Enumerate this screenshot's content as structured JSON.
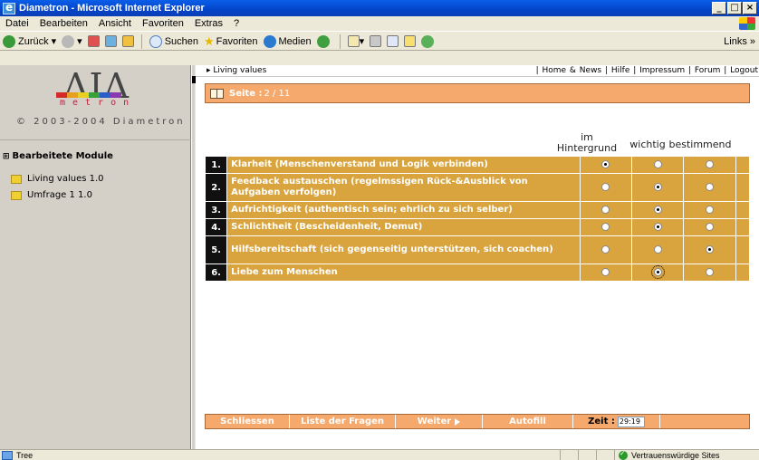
{
  "window": {
    "title": "Diametron - Microsoft Internet Explorer"
  },
  "menu": [
    "Datei",
    "Bearbeiten",
    "Ansicht",
    "Favoriten",
    "Extras",
    "?"
  ],
  "toolbar": {
    "back_label": "Zurück",
    "search_label": "Suchen",
    "favorites_label": "Favoriten",
    "media_label": "Medien",
    "links_label": "Links »"
  },
  "sidebar": {
    "logo_text": "ΔΙΛ",
    "logo_sub": "metron",
    "copyright": "© 2003-2004 Diametron",
    "modules_heading": "Bearbeitete Module",
    "modules": [
      "Living values 1.0",
      "Umfrage 1 1.0"
    ],
    "logo_colors": [
      "#d42a2a",
      "#e8a020",
      "#e8d020",
      "#3aa03a",
      "#2c5cc8",
      "#8a3ab0"
    ]
  },
  "content": {
    "breadcrumb": "Living values",
    "top_links": "| Home & News | Hilfe | Impressum | Forum | Logout",
    "seite_label": "Seite :",
    "seite_value": "2 / 11",
    "columns": [
      "im Hintergrund",
      "wichtig",
      "bestimmend"
    ],
    "questions": [
      {
        "num": "1.",
        "text": "Klarheit (Menschenverstand und Logik verbinden)",
        "selected": 0
      },
      {
        "num": "2.",
        "text": "Feedback austauschen (regelmssigen Rück-&Ausblick von Aufgaben verfolgen)",
        "selected": 1
      },
      {
        "num": "3.",
        "text": "Aufrichtigkeit (authentisch sein; ehrlich zu sich selber)",
        "selected": 1
      },
      {
        "num": "4.",
        "text": "Schlichtheit (Bescheidenheit, Demut)",
        "selected": 1
      },
      {
        "num": "5.",
        "text": "Hilfsbereitschaft (sich gegenseitig unterstützen, sich coachen)",
        "selected": 2
      },
      {
        "num": "6.",
        "text": "Liebe zum Menschen",
        "selected": 1
      }
    ],
    "bottom": {
      "close_label": "Schliessen",
      "list_label": "Liste der Fragen",
      "next_label": "Weiter",
      "autofill_label": "Autofill",
      "time_label": "Zeit :",
      "time_value": "29:19"
    }
  },
  "status": {
    "left_text": "Tree",
    "trust_text": "Vertrauenswürdige Sites"
  }
}
